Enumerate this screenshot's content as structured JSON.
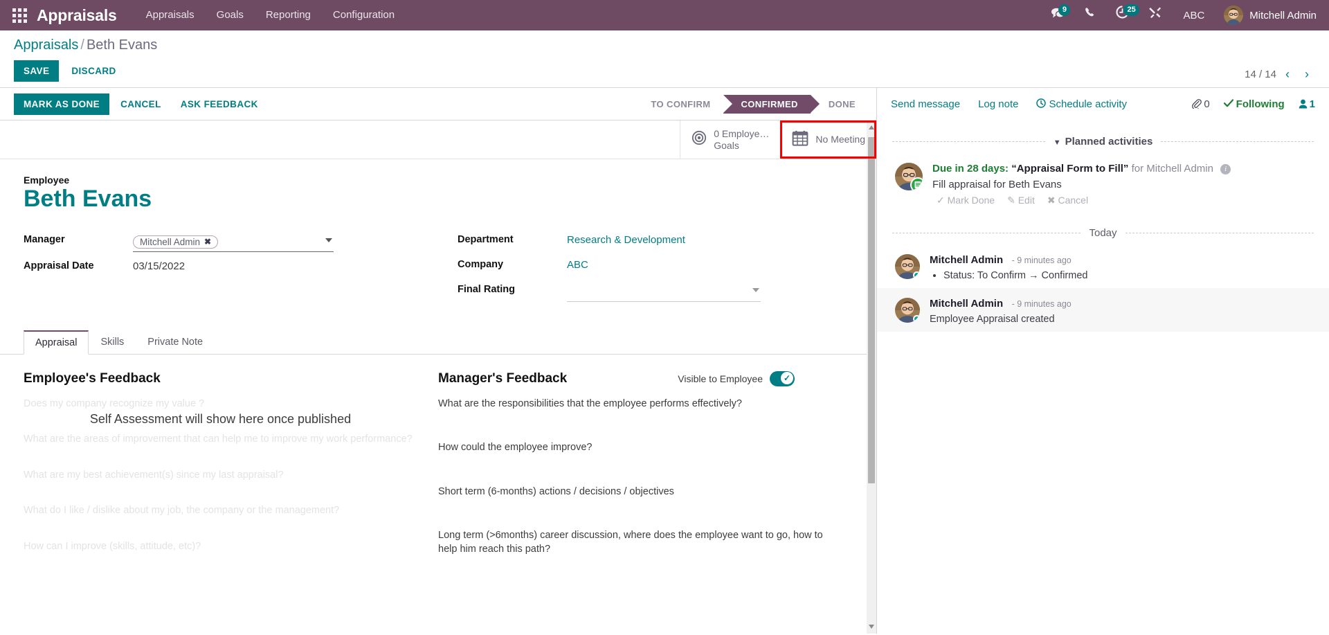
{
  "navbar": {
    "apps_icon": "apps-grid-icon",
    "brand": "Appraisals",
    "menus": [
      "Appraisals",
      "Goals",
      "Reporting",
      "Configuration"
    ],
    "messages_badge": "9",
    "activities_badge": "25",
    "company": "ABC",
    "user": "Mitchell Admin"
  },
  "control_panel": {
    "breadcrumb_root": "Appraisals",
    "breadcrumb_sep": "/",
    "breadcrumb_current": "Beth Evans",
    "save_label": "SAVE",
    "discard_label": "DISCARD",
    "pager_text": "14 / 14",
    "pager_prev": "‹",
    "pager_next": "›"
  },
  "statusbar": {
    "buttons": [
      "MARK AS DONE",
      "CANCEL",
      "ASK FEEDBACK"
    ],
    "stages": [
      {
        "label": "TO CONFIRM",
        "active": false
      },
      {
        "label": "CONFIRMED",
        "active": true
      },
      {
        "label": "DONE",
        "active": false
      }
    ]
  },
  "smart_buttons": [
    {
      "icon": "target-icon",
      "line1": "0 Employe…",
      "line2": "Goals",
      "highlighted": false
    },
    {
      "icon": "calendar-icon",
      "line1": "No Meeting",
      "line2": "",
      "highlighted": true
    }
  ],
  "form": {
    "employee_label": "Employee",
    "employee_name": "Beth Evans",
    "manager_label": "Manager",
    "manager_value": "Mitchell Admin",
    "manager_tag_remove": "✖",
    "appraisal_date_label": "Appraisal Date",
    "appraisal_date_value": "03/15/2022",
    "department_label": "Department",
    "department_value": "Research & Development",
    "company_label": "Company",
    "company_value": "ABC",
    "final_rating_label": "Final Rating",
    "final_rating_value": ""
  },
  "tabs": [
    {
      "label": "Appraisal",
      "active": true
    },
    {
      "label": "Skills",
      "active": false
    },
    {
      "label": "Private Note",
      "active": false
    }
  ],
  "employee_feedback": {
    "title": "Employee's Feedback",
    "overlay": "Self Assessment will show here once published",
    "ghost_lines": [
      "Does my company recognize my value ?",
      "What are the areas of improvement that can help me to improve my work performance?",
      "What are my best achievement(s) since my last appraisal?",
      "What do I like / dislike about my job, the company or the management?",
      "How can I improve (skills, attitude, etc)?"
    ]
  },
  "manager_feedback": {
    "title": "Manager's Feedback",
    "visible_label": "Visible to Employee",
    "visible_on": true,
    "questions": [
      "What are the responsibilities that the employee performs effectively?",
      "How could the employee improve?",
      "Short term (6-months) actions / decisions / objectives",
      "Long term (>6months) career discussion, where does the employee want to go, how to help him reach this path?"
    ]
  },
  "chatter": {
    "send_message": "Send message",
    "log_note": "Log note",
    "schedule_activity": "Schedule activity",
    "attachment_count": "0",
    "following_label": "Following",
    "followers_count": "1",
    "planned_activities_label": "Planned activities",
    "today_label": "Today",
    "activity": {
      "due": "Due in 28 days:",
      "name": "“Appraisal Form to Fill”",
      "assigned": "for Mitchell Admin",
      "summary_prefix": "Fill appraisal for ",
      "summary_link": "Beth Evans",
      "mark_done": "Mark Done",
      "edit": "Edit",
      "cancel": "Cancel"
    },
    "messages": [
      {
        "author": "Mitchell Admin",
        "time": "9 minutes ago",
        "body": "Status: To Confirm → Confirmed",
        "is_list": true
      },
      {
        "author": "Mitchell Admin",
        "time": "9 minutes ago",
        "body": "Employee Appraisal created",
        "is_list": false
      }
    ]
  },
  "colors": {
    "brand_purple": "#714b67",
    "navbar_purple": "#6e4a63",
    "teal": "#017e84",
    "green": "#1e7e34",
    "highlight_red": "#f60000"
  }
}
